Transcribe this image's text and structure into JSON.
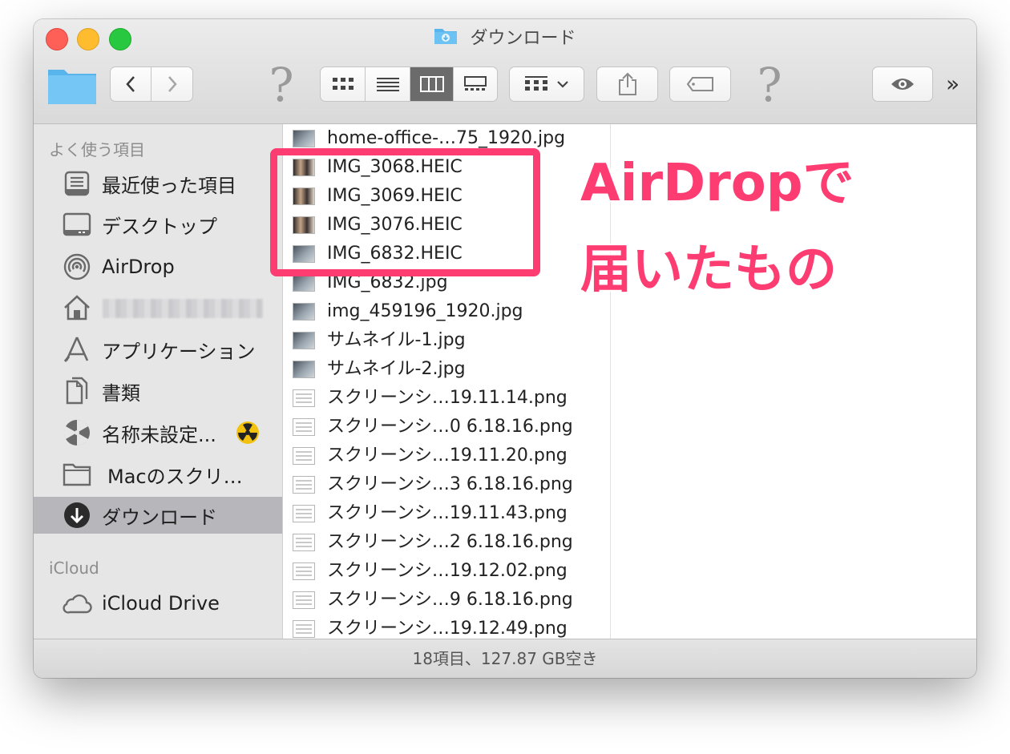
{
  "window": {
    "title": "ダウンロード"
  },
  "toolbar": {
    "back_icon": "chevron-left-icon",
    "forward_icon": "chevron-right-icon",
    "help_mark": "?",
    "overflow": "»"
  },
  "sidebar": {
    "favorites_heading": "よく使う項目",
    "favorites": [
      {
        "label": "最近使った項目",
        "icon": "recents-icon"
      },
      {
        "label": "デスクトップ",
        "icon": "desktop-icon"
      },
      {
        "label": "AirDrop",
        "icon": "airdrop-icon"
      },
      {
        "label": "",
        "icon": "home-icon"
      },
      {
        "label": "アプリケーション",
        "icon": "applications-icon"
      },
      {
        "label": "書類",
        "icon": "documents-icon"
      },
      {
        "label": "名称未設定...",
        "icon": "disk-icon"
      },
      {
        "label": "Macのスクリ…",
        "icon": "folder-icon"
      },
      {
        "label": "ダウンロード",
        "icon": "downloads-icon",
        "selected": true
      }
    ],
    "icloud_heading": "iCloud",
    "icloud": [
      {
        "label": "iCloud Drive",
        "icon": "cloud-icon"
      }
    ]
  },
  "files": [
    {
      "name": "home-office-…75_1920.jpg",
      "kind": "img"
    },
    {
      "name": "IMG_3068.HEIC",
      "kind": "photo"
    },
    {
      "name": "IMG_3069.HEIC",
      "kind": "photo"
    },
    {
      "name": "IMG_3076.HEIC",
      "kind": "photo"
    },
    {
      "name": "IMG_6832.HEIC",
      "kind": "img"
    },
    {
      "name": "IMG_6832.jpg",
      "kind": "img"
    },
    {
      "name": "img_459196_1920.jpg",
      "kind": "img"
    },
    {
      "name": "サムネイル-1.jpg",
      "kind": "img"
    },
    {
      "name": "サムネイル-2.jpg",
      "kind": "img"
    },
    {
      "name": "スクリーンシ…19.11.14.png",
      "kind": "doc"
    },
    {
      "name": "スクリーンシ…0 6.18.16.png",
      "kind": "doc"
    },
    {
      "name": "スクリーンシ…19.11.20.png",
      "kind": "doc"
    },
    {
      "name": "スクリーンシ…3 6.18.16.png",
      "kind": "doc"
    },
    {
      "name": "スクリーンシ…19.11.43.png",
      "kind": "doc"
    },
    {
      "name": "スクリーンシ…2 6.18.16.png",
      "kind": "doc"
    },
    {
      "name": "スクリーンシ…19.12.02.png",
      "kind": "doc"
    },
    {
      "name": "スクリーンシ…9 6.18.16.png",
      "kind": "doc"
    },
    {
      "name": "スクリーンシ…19.12.49.png",
      "kind": "doc"
    }
  ],
  "status_bar": {
    "text": "18項目、127.87 GB空き"
  },
  "annotation": {
    "line1": "AirDropで",
    "line2": "届いたもの",
    "color": "#fd3c72"
  }
}
